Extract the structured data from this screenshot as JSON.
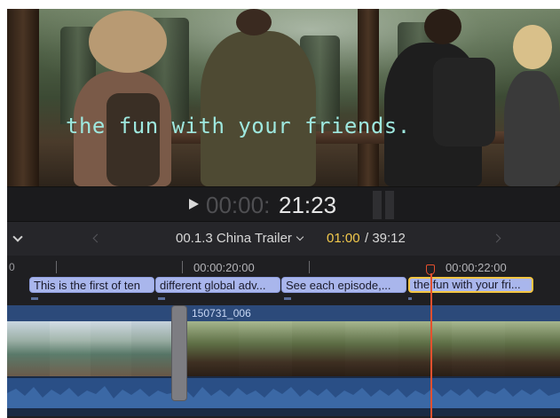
{
  "viewer": {
    "subtitle": "the fun with your friends."
  },
  "transport": {
    "timecode_dim": "00:00:",
    "timecode_main": "21:23"
  },
  "timeline_header": {
    "project_name": "00.1.3 China Trailer",
    "current_duration": "01:00",
    "separator_total": "/ 39:12"
  },
  "ruler": {
    "start_label": "0",
    "labels": [
      "00:00:20:00",
      "00:00:22:00"
    ]
  },
  "captions": [
    {
      "text": "This is the first of ten",
      "selected": false
    },
    {
      "text": "different global adv...",
      "selected": false
    },
    {
      "text": "See each episode,...",
      "selected": false
    },
    {
      "text": "the fun with your fri...",
      "selected": true
    }
  ],
  "clip": {
    "name": "150731_006"
  },
  "colors": {
    "caption_fill": "#a9b6ec",
    "selection_border": "#f4c542",
    "playhead": "#e4502e",
    "duration_highlight": "#f2c94c",
    "subtitle": "#9ee8df"
  }
}
